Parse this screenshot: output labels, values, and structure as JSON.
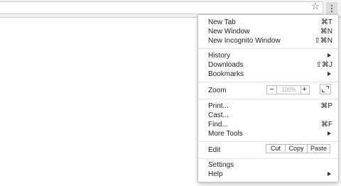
{
  "toolbar": {
    "star_icon": "star-outline-icon",
    "menu_icon": "three-dots-vertical-icon"
  },
  "menu": {
    "new_tab": {
      "label": "New Tab",
      "shortcut": "⌘T"
    },
    "new_window": {
      "label": "New Window",
      "shortcut": "⌘N"
    },
    "new_incognito": {
      "label": "New Incognito Window",
      "shortcut": "⇧⌘N"
    },
    "history": {
      "label": "History"
    },
    "downloads": {
      "label": "Downloads",
      "shortcut": "⇧⌘J"
    },
    "bookmarks": {
      "label": "Bookmarks"
    },
    "zoom": {
      "label": "Zoom",
      "minus": "−",
      "value": "100%",
      "plus": "+"
    },
    "print": {
      "label": "Print...",
      "shortcut": "⌘P"
    },
    "cast": {
      "label": "Cast..."
    },
    "find": {
      "label": "Find...",
      "shortcut": "⌘F"
    },
    "more_tools": {
      "label": "More Tools"
    },
    "edit": {
      "label": "Edit",
      "cut": "Cut",
      "copy": "Copy",
      "paste": "Paste"
    },
    "settings": {
      "label": "Settings"
    },
    "help": {
      "label": "Help"
    }
  }
}
